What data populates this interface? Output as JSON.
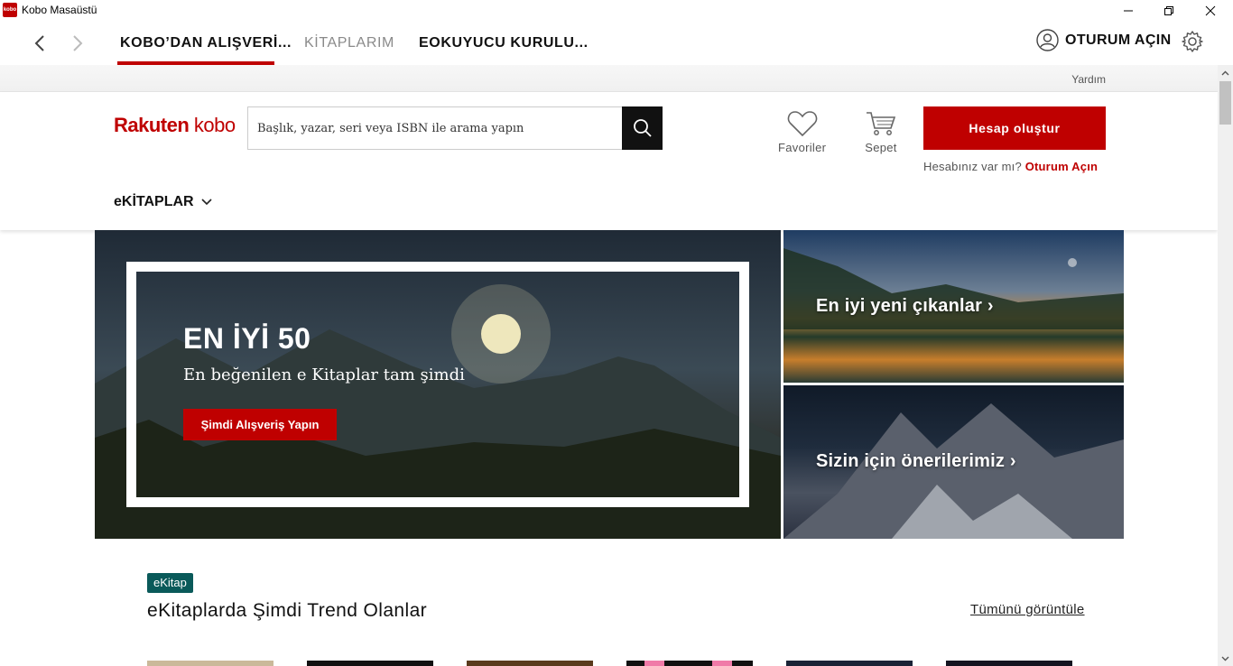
{
  "window": {
    "title": "Kobo Masaüstü",
    "app_icon_text": "kobo"
  },
  "nav": {
    "tabs": [
      {
        "label": "KOBO’DAN ALIŞVERİ...",
        "active": true
      },
      {
        "label": "KİTAPLARIM",
        "active": false
      },
      {
        "label": "EOKUYUCU KURULU...",
        "active": false
      }
    ],
    "signin_label": "OTURUM AÇIN"
  },
  "help": {
    "label": "Yardım"
  },
  "header": {
    "logo_part1": "Rakuten",
    "logo_part2": "kobo",
    "search_placeholder": "Başlık, yazar, seri veya ISBN ile arama yapın",
    "favorites_label": "Favoriler",
    "cart_label": "Sepet",
    "create_account_label": "Hesap oluştur",
    "have_account_text": "Hesabınız var mı?",
    "signin_link": "Oturum Açın",
    "ebooks_menu_label": "eKİTAPLAR"
  },
  "hero": {
    "main_title": "EN İYİ 50",
    "main_subtitle": "En beğenilen e Kitaplar tam şimdi",
    "main_button": "Şimdi Alışveriş Yapın",
    "side1_label": "En iyi yeni çıkanlar ›",
    "side2_label": "Sizin için önerilerimiz ›"
  },
  "section": {
    "badge": "eKitap",
    "title": "eKitaplarda Şimdi Trend Olanlar",
    "view_all": "Tümünü görüntüle"
  },
  "colors": {
    "brand": "#bf0000",
    "badge": "#0a5a5a"
  },
  "icons": {
    "back": "chevron-left-icon",
    "forward": "chevron-right-icon",
    "user": "user-circle-icon",
    "settings": "gear-icon",
    "search": "search-icon",
    "favorites": "heart-icon",
    "cart": "cart-icon",
    "menu": "chevron-down-icon"
  }
}
